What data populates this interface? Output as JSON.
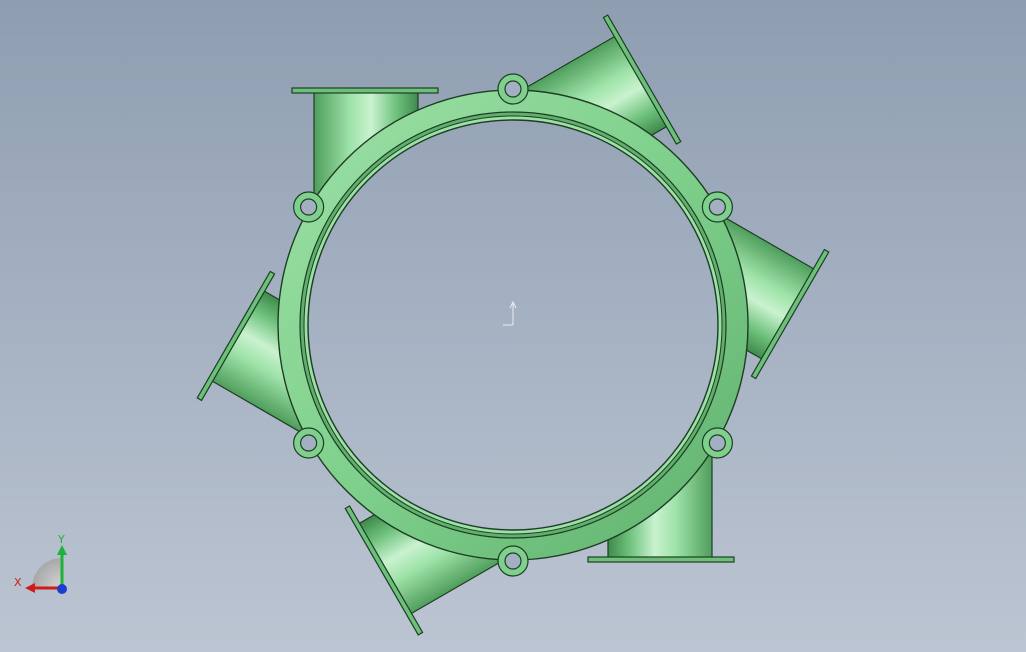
{
  "viewport": {
    "background_top": "#8e9db0",
    "background_bottom": "#bcc5d2"
  },
  "model": {
    "color": "#7fd08c",
    "edge_color": "#1f3d24",
    "highlight_color": "#c9f2cf",
    "shadow_color": "#3f8a4d",
    "pipe_count": 6,
    "bolt_hole_count": 6
  },
  "triad": {
    "x_label": "X",
    "y_label": "Y",
    "x_color": "#d11a1a",
    "y_color": "#1db33a",
    "z_color": "#1a3cd1"
  },
  "origin_marker": {
    "color": "#e8edf3"
  }
}
